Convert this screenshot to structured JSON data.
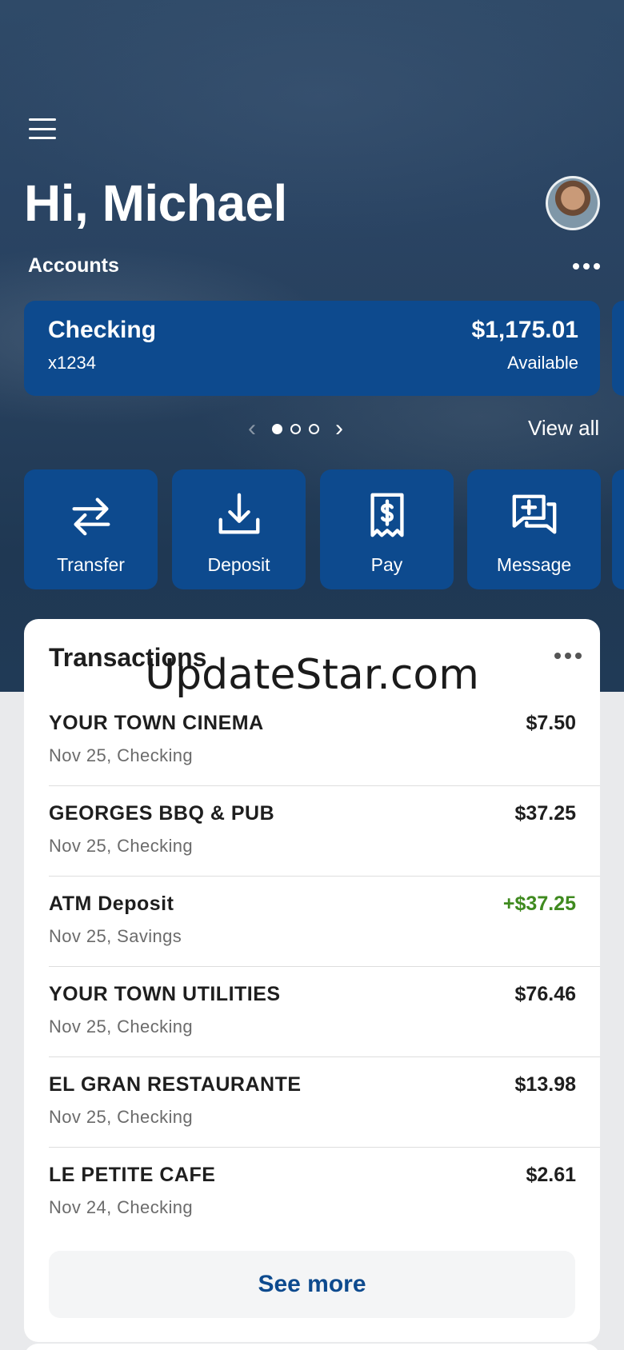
{
  "header": {
    "greeting": "Hi, Michael",
    "accounts_label": "Accounts"
  },
  "account": {
    "name": "Checking",
    "number": "x1234",
    "balance": "$1,175.01",
    "balance_label": "Available"
  },
  "carousel": {
    "total_pages": 3,
    "active_page": 1,
    "view_all": "View all"
  },
  "actions": [
    {
      "label": "Transfer",
      "icon": "transfer-arrows-icon"
    },
    {
      "label": "Deposit",
      "icon": "download-tray-icon"
    },
    {
      "label": "Pay",
      "icon": "dollar-receipt-icon"
    },
    {
      "label": "Message",
      "icon": "chat-plus-icon"
    }
  ],
  "transactions": {
    "title": "Transactions",
    "items": [
      {
        "merchant": "YOUR TOWN CINEMA",
        "meta": "Nov 25, Checking",
        "amount": "$7.50",
        "credit": false
      },
      {
        "merchant": "GEORGES BBQ & PUB",
        "meta": "Nov 25, Checking",
        "amount": "$37.25",
        "credit": false
      },
      {
        "merchant": "ATM Deposit",
        "meta": "Nov 25, Savings",
        "amount": "+$37.25",
        "credit": true
      },
      {
        "merchant": "YOUR TOWN UTILITIES",
        "meta": "Nov 25, Checking",
        "amount": "$76.46",
        "credit": false
      },
      {
        "merchant": "EL GRAN RESTAURANTE",
        "meta": "Nov 25, Checking",
        "amount": "$13.98",
        "credit": false
      },
      {
        "merchant": "LE PETITE CAFE",
        "meta": "Nov 24, Checking",
        "amount": "$2.61",
        "credit": false
      }
    ],
    "see_more": "See more"
  },
  "watermark": "UpdateStar.com",
  "colors": {
    "brand_blue": "#0d4a8e",
    "credit_green": "#3f8a1f"
  }
}
